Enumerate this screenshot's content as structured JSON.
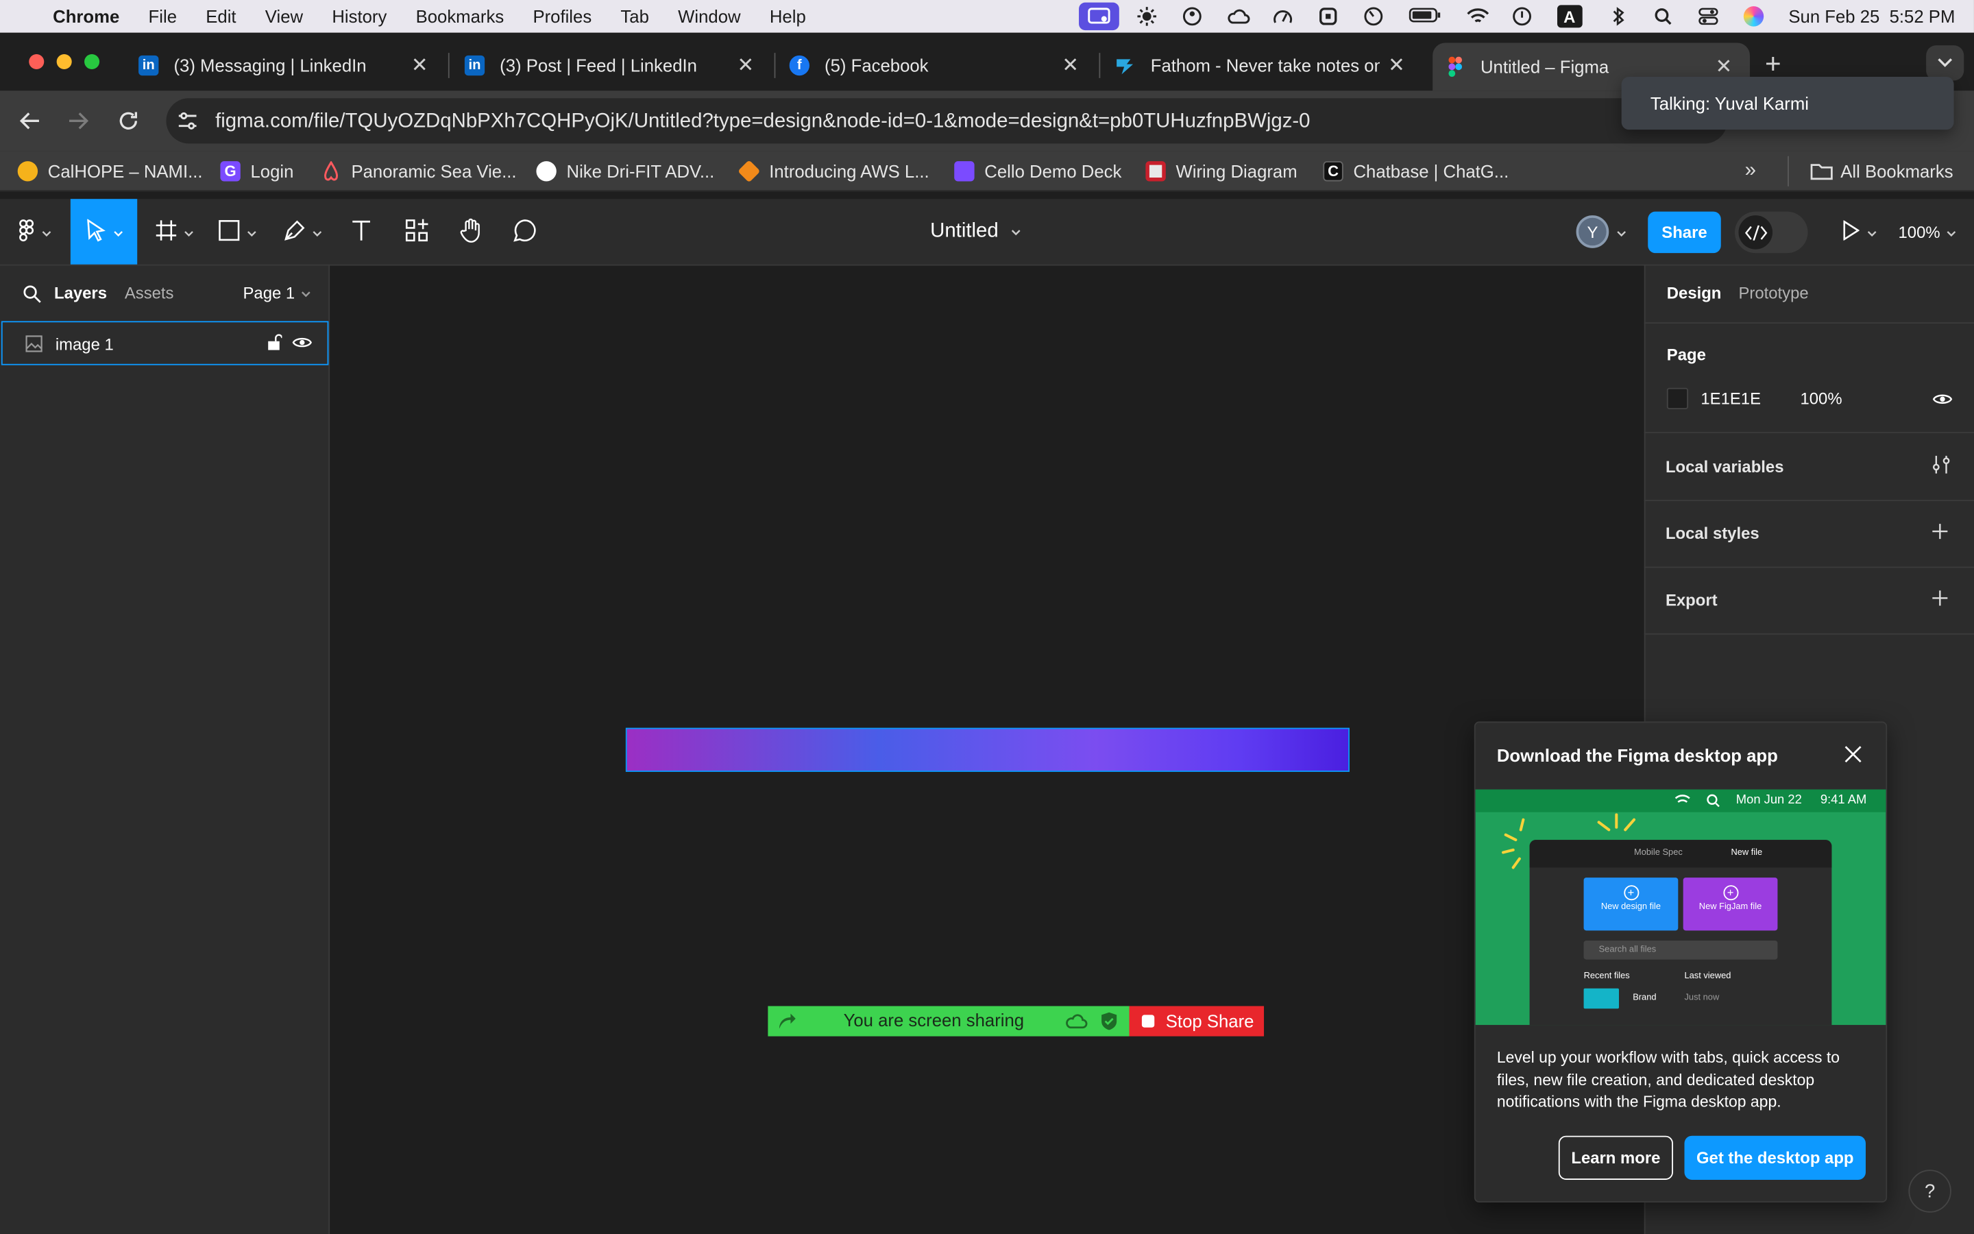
{
  "menubar": {
    "app": "Chrome",
    "items": [
      "File",
      "Edit",
      "View",
      "History",
      "Bookmarks",
      "Profiles",
      "Tab",
      "Window",
      "Help"
    ],
    "datetime": "Sun Feb 25  5:52 PM",
    "input_indicator": "A"
  },
  "tabs": [
    {
      "title": "(3) Messaging | LinkedIn",
      "icon": "linkedin-icon"
    },
    {
      "title": "(3) Post | Feed | LinkedIn",
      "icon": "linkedin-icon"
    },
    {
      "title": "(5) Facebook",
      "icon": "facebook-icon"
    },
    {
      "title": "Fathom - Never take notes on",
      "icon": "fathom-icon"
    },
    {
      "title": "Untitled – Figma",
      "icon": "figma-icon"
    }
  ],
  "address": {
    "url": "figma.com/file/TQUyOZDqNbPXh7CQHPyOjK/Untitled?type=design&node-id=0-1&mode=design&t=pb0TUHuzfnpBWjgz-0"
  },
  "talking_popup": "Talking: Yuval Karmi",
  "bookmarks": [
    {
      "label": "CalHOPE – NAMI...",
      "color": "#f5b21b"
    },
    {
      "label": "Login",
      "color": "#7b4bff"
    },
    {
      "label": "Panoramic Sea Vie...",
      "color": "#ff5a5f"
    },
    {
      "label": "Nike Dri-FIT ADV...",
      "color": "#ffffff"
    },
    {
      "label": "Introducing AWS L...",
      "color": "#f28a1a"
    },
    {
      "label": "Cello Demo Deck",
      "color": "#7b4bff"
    },
    {
      "label": "Wiring Diagram",
      "color": "#e8e8e8"
    },
    {
      "label": "Chatbase | ChatG...",
      "color": "#111111"
    }
  ],
  "all_bookmarks": "All Bookmarks",
  "figma": {
    "file_title": "Untitled",
    "avatar": "Y",
    "share": "Share",
    "zoom": "100%",
    "left_tabs": {
      "layers": "Layers",
      "assets": "Assets",
      "page": "Page 1"
    },
    "layers": [
      {
        "name": "image 1"
      }
    ],
    "right_tabs": {
      "design": "Design",
      "prototype": "Prototype"
    },
    "page_section": {
      "title": "Page",
      "color_hex": "1E1E1E",
      "opacity": "100%"
    },
    "sections": [
      "Local variables",
      "Local styles",
      "Export"
    ],
    "canvas_gradient": [
      "#9b2fc4",
      "#4a5de8",
      "#7b4df0",
      "#5f3cf2",
      "#4a1fe0"
    ]
  },
  "screenshare": {
    "label": "You are screen sharing",
    "stop": "Stop Share"
  },
  "download_card": {
    "title": "Download the Figma desktop app",
    "preview": {
      "date": "Mon Jun 22",
      "time": "9:41 AM",
      "tab1": "Mobile Spec",
      "tab2": "New file",
      "new_design": "New design file",
      "new_figjam": "New FigJam file",
      "search": "Search all files",
      "recent": "Recent files",
      "last_viewed": "Last viewed",
      "brand": "Brand",
      "just_now": "Just now"
    },
    "body": "Level up your workflow with tabs, quick access to files, new file creation, and dedicated desktop notifications with the Figma desktop app.",
    "learn_more": "Learn more",
    "get_app": "Get the desktop app"
  },
  "help": "?"
}
